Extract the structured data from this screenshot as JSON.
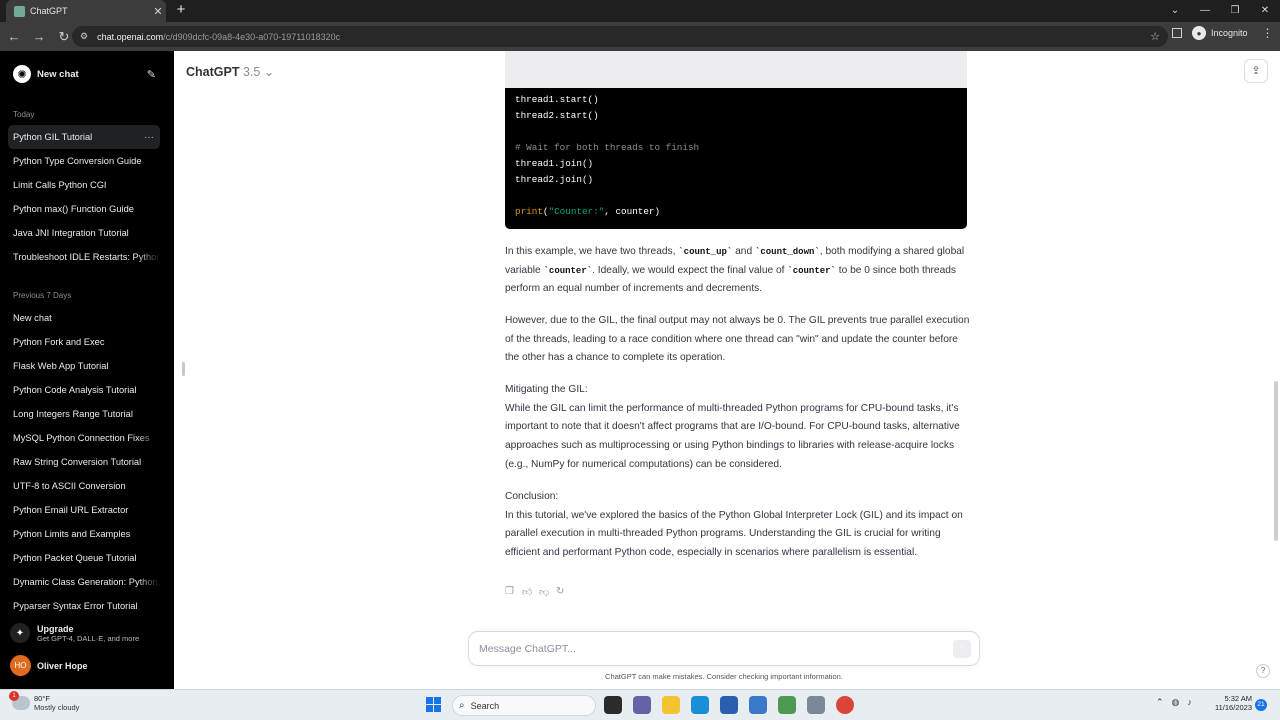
{
  "browser": {
    "tab_title": "ChatGPT",
    "url_host": "chat.openai.com",
    "url_path": "/c/d909dcfc-09a8-4e30-a070-19711018320c",
    "profile_label": "Incognito"
  },
  "sidebar": {
    "new_chat_label": "New chat",
    "today_title": "Today",
    "today_items": [
      "Python GIL Tutorial",
      "Python Type Conversion Guide",
      "Limit Calls Python CGI",
      "Python max() Function Guide",
      "Java JNI Integration Tutorial",
      "Troubleshoot IDLE Restarts: Python"
    ],
    "prev_title": "Previous 7 Days",
    "prev_items": [
      "New chat",
      "Python Fork and Exec",
      "Flask Web App Tutorial",
      "Python Code Analysis Tutorial",
      "Long Integers Range Tutorial",
      "MySQL Python Connection Fixes",
      "Raw String Conversion Tutorial",
      "UTF-8 to ASCII Conversion",
      "Python Email URL Extractor",
      "Python Limits and Examples",
      "Python Packet Queue Tutorial",
      "Dynamic Class Generation: Python",
      "Pyparser Syntax Error Tutorial"
    ],
    "upgrade_title": "Upgrade",
    "upgrade_sub": "Get GPT-4, DALL·E, and more",
    "user_initials": "HO",
    "user_name": "Oliver Hope"
  },
  "main": {
    "model_name": "ChatGPT",
    "model_version": "3.5",
    "code": {
      "l1": "thread1.start()",
      "l2": "thread2.start()",
      "l3": "# Wait for both threads to finish",
      "l4": "thread1.join()",
      "l5": "thread2.join()",
      "l6_fn": "print",
      "l6_open": "(",
      "l6_str": "\"Counter:\"",
      "l6_rest": ", counter)"
    },
    "p1": {
      "a": "In this example, we have two threads, ",
      "c1": "`count_up`",
      "b": " and ",
      "c2": "`count_down`",
      "c": ", both modifying a shared global variable ",
      "c3": "`counter`",
      "d": ". Ideally, we would expect the final value of ",
      "c4": "`counter`",
      "e": " to be 0 since both threads perform an equal number of increments and decrements."
    },
    "p2": "However, due to the GIL, the final output may not always be 0. The GIL prevents true parallel execution of the threads, leading to a race condition where one thread can \"win\" and update the counter before the other has a chance to complete its operation.",
    "p3_title": "Mitigating the GIL:",
    "p3": "While the GIL can limit the performance of multi-threaded Python programs for CPU-bound tasks, it's important to note that it doesn't affect programs that are I/O-bound. For CPU-bound tasks, alternative approaches such as multiprocessing or using Python bindings to libraries with release-acquire locks (e.g., NumPy for numerical computations) can be considered.",
    "p4_title": "Conclusion:",
    "p4": "In this tutorial, we've explored the basics of the Python Global Interpreter Lock (GIL) and its impact on parallel execution in multi-threaded Python programs. Understanding the GIL is crucial for writing efficient and performant Python code, especially in scenarios where parallelism is essential.",
    "composer_placeholder": "Message ChatGPT...",
    "disclaimer": "ChatGPT can make mistakes. Consider checking important information.",
    "help_label": "?"
  },
  "taskbar": {
    "weather_badge": "1",
    "temp": "80°F",
    "condition": "Mostly cloudy",
    "search_label": "Search",
    "time": "5:32 AM",
    "date": "11/16/2023",
    "notif_count": "21"
  }
}
